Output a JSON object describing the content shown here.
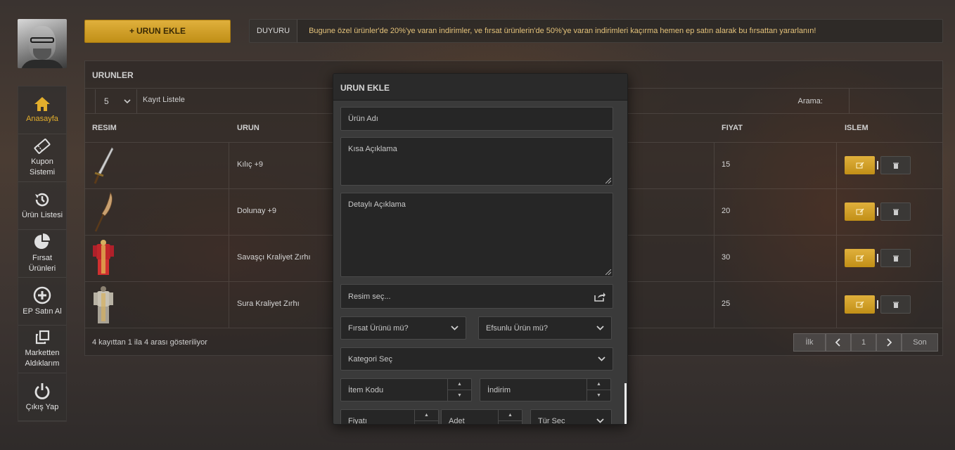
{
  "sidebar": {
    "items": [
      {
        "label": "Anasayfa",
        "icon": "home-icon"
      },
      {
        "label": "Kupon\nSistemi",
        "icon": "ticket-icon"
      },
      {
        "label": "Ürün Listesi",
        "icon": "history-icon"
      },
      {
        "label": "Fırsat Ürünleri",
        "icon": "pie-chart-icon"
      },
      {
        "label": "EP Satın Al",
        "icon": "plus-circle-icon"
      },
      {
        "label": "Marketten\nAldıklarım",
        "icon": "clone-icon"
      },
      {
        "label": "Çıkış Yap",
        "icon": "power-icon"
      }
    ]
  },
  "topbar": {
    "add_label": "URUN EKLE",
    "announce_tag": "DUYURU",
    "announce_msg": "Bugune özel ürünler'de 20%'ye varan indirimler, ve fırsat ürünlerin'de 50%'ye varan indirimleri kaçırma hemen ep satın alarak bu fırsattan yararlanın!"
  },
  "panel": {
    "title": "URUNLER",
    "page_size": "5",
    "page_size_label": "Kayıt Listele",
    "search_label": "Arama:",
    "columns": {
      "image": "RESIM",
      "product": "URUN",
      "price": "FIYAT",
      "action": "ISLEM"
    },
    "rows": [
      {
        "name": "Kılıç +9",
        "price": "15",
        "image": "sword"
      },
      {
        "name": "Dolunay +9",
        "price": "20",
        "image": "glaive"
      },
      {
        "name": "Savaşçı Kraliyet Zırhı",
        "price": "30",
        "image": "red-armor"
      },
      {
        "name": "Sura Kraliyet Zırhı",
        "price": "25",
        "image": "white-armor"
      }
    ],
    "info": "4 kayıttan 1 ila 4 arası gösteriliyor",
    "pager": {
      "first": "İlk",
      "page": "1",
      "last": "Son"
    }
  },
  "modal": {
    "title": "URUN EKLE",
    "name_ph": "Ürün Adı",
    "short_desc_ph": "Kısa Açıklama",
    "detail_desc_ph": "Detaylı Açıklama",
    "image_label": "Resim seç...",
    "deal_select": "Fırsat Ürünü mü?",
    "bonus_select": "Efsunlu Ürün mü?",
    "category_select": "Kategori Seç",
    "item_code_ph": "İtem Kodu",
    "discount_ph": "İndirim",
    "price_ph": "Fiyatı",
    "qty_ph": "Adet",
    "type_select": "Tür Sec"
  },
  "colors": {
    "accent": "#e2ae2c",
    "modal_bg": "#3a3a3a",
    "field_bg": "#262626"
  }
}
